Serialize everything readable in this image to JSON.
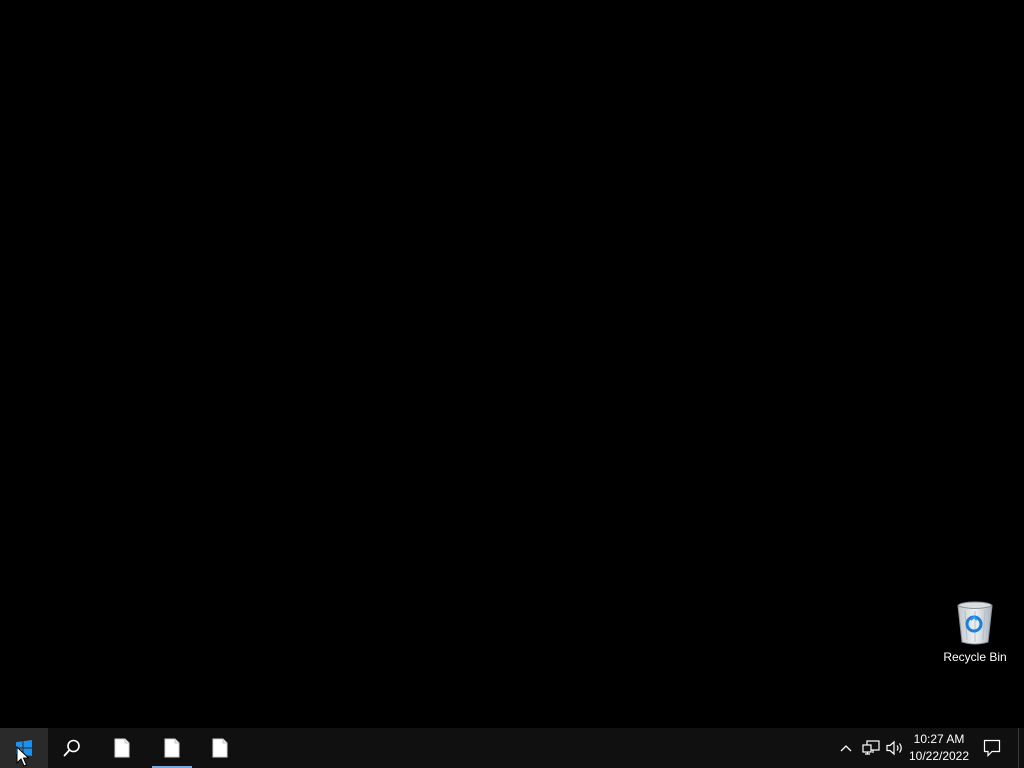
{
  "desktop": {
    "background": "#000000",
    "icons": [
      {
        "label": "Recycle Bin",
        "icon": "recycle-bin-icon"
      }
    ]
  },
  "taskbar": {
    "start": {
      "icon": "windows-logo-icon",
      "accent": "#1e90e8"
    },
    "search": {
      "icon": "search-icon"
    },
    "apps": [
      {
        "icon": "document-icon",
        "active": false
      },
      {
        "icon": "document-icon",
        "active": true
      },
      {
        "icon": "document-icon",
        "active": false
      }
    ],
    "active_indicator_color": "#7aa7e0",
    "tray": {
      "chevron": "chevron-up-icon",
      "network": "network-icon",
      "volume": "volume-icon",
      "time": "10:27 AM",
      "date": "10/22/2022",
      "notifications": "action-center-icon"
    }
  }
}
